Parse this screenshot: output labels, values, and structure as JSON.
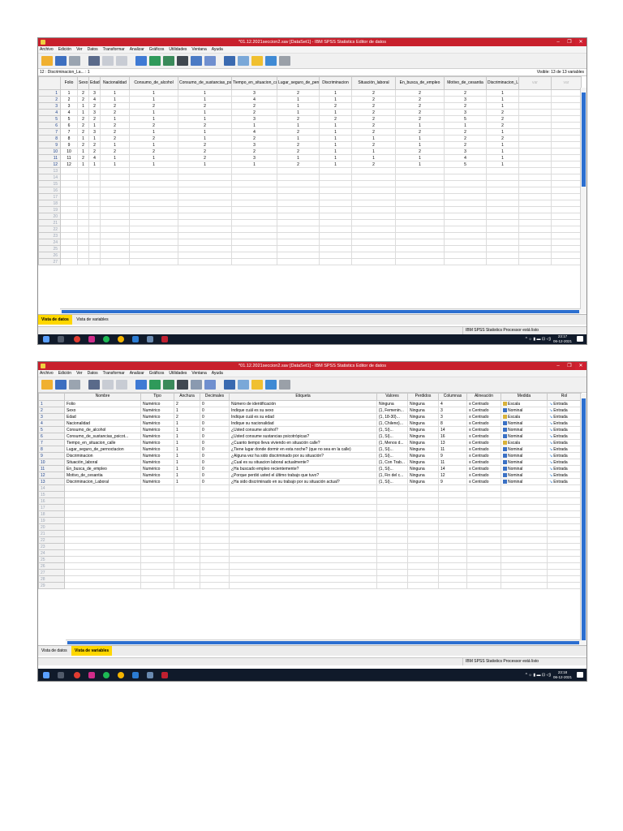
{
  "window": {
    "title": "*01.12.2021seccion2.sav [DataSet1] - IBM SPSS Statistics Editor de datos",
    "minimize": "–",
    "maximize": "❐",
    "close": "✕"
  },
  "menu": [
    "Archivo",
    "Edición",
    "Ver",
    "Datos",
    "Transformar",
    "Analizar",
    "Gráficos",
    "Utilidades",
    "Ventana",
    "Ayuda"
  ],
  "toolbar_icons": [
    "open-icon",
    "save-icon",
    "print-icon",
    "dialog-recall-icon",
    "undo-icon",
    "redo-icon",
    "goto-case-icon",
    "goto-variable-icon",
    "variables-icon",
    "find-icon",
    "insert-cases-icon",
    "insert-variable-icon",
    "split-file-icon",
    "weight-cases-icon",
    "select-cases-icon",
    "value-labels-icon",
    "use-sets-icon"
  ],
  "data_view": {
    "cell_ref": "12 : Discriminacion_La... : 1",
    "visible_label": "Visible: 13 de 13 variables",
    "columns": [
      "Folio",
      "Sexo",
      "Edad",
      "Nacionalidad",
      "Consumo_de_alcohol",
      "Consumo_de_sustancias_psicotropicas",
      "Tiempo_en_situacion_calle",
      "Lugar_seguro_de_pernoctacion",
      "Discriminacion",
      "Situación_laboral",
      "En_busca_de_empleo",
      "Motivo_de_cesantia",
      "Discriminacion_Laboral",
      "var",
      "var"
    ],
    "rows": [
      [
        "1",
        "2",
        "3",
        "1",
        "1",
        "1",
        "3",
        "2",
        "1",
        "2",
        "2",
        "2",
        "1"
      ],
      [
        "2",
        "2",
        "4",
        "1",
        "1",
        "1",
        "4",
        "1",
        "1",
        "2",
        "2",
        "3",
        "1"
      ],
      [
        "3",
        "1",
        "2",
        "2",
        "2",
        "2",
        "2",
        "1",
        "2",
        "2",
        "2",
        "2",
        "1"
      ],
      [
        "4",
        "1",
        "3",
        "2",
        "1",
        "1",
        "2",
        "1",
        "1",
        "2",
        "2",
        "3",
        "2"
      ],
      [
        "5",
        "2",
        "2",
        "1",
        "1",
        "1",
        "3",
        "2",
        "2",
        "2",
        "2",
        "5",
        "2"
      ],
      [
        "6",
        "2",
        "1",
        "2",
        "2",
        "2",
        "1",
        "1",
        "1",
        "2",
        "1",
        "1",
        "2"
      ],
      [
        "7",
        "2",
        "3",
        "2",
        "1",
        "1",
        "4",
        "2",
        "1",
        "2",
        "2",
        "2",
        "1"
      ],
      [
        "8",
        "1",
        "1",
        "2",
        "2",
        "1",
        "2",
        "1",
        "1",
        "1",
        "1",
        "2",
        "2"
      ],
      [
        "9",
        "2",
        "2",
        "1",
        "1",
        "2",
        "3",
        "2",
        "1",
        "2",
        "1",
        "2",
        "1"
      ],
      [
        "10",
        "1",
        "2",
        "2",
        "2",
        "2",
        "2",
        "2",
        "1",
        "1",
        "2",
        "3",
        "1"
      ],
      [
        "11",
        "2",
        "4",
        "1",
        "1",
        "2",
        "3",
        "1",
        "1",
        "1",
        "1",
        "4",
        "1"
      ],
      [
        "12",
        "1",
        "1",
        "1",
        "1",
        "1",
        "1",
        "2",
        "1",
        "2",
        "1",
        "5",
        "1"
      ]
    ],
    "row_numbers": [
      "1",
      "2",
      "3",
      "4",
      "5",
      "6",
      "7",
      "8",
      "9",
      "10",
      "11",
      "12",
      "13",
      "14",
      "15",
      "16",
      "17",
      "18",
      "19",
      "20",
      "21",
      "22",
      "23",
      "24",
      "25",
      "26",
      "27"
    ],
    "tab_data": "Vista de datos",
    "tab_vars": "Vista de variables"
  },
  "var_view": {
    "headers": [
      "Nombre",
      "Tipo",
      "Anchura",
      "Decimales",
      "Etiqueta",
      "Valores",
      "Perdidos",
      "Columnas",
      "Alineación",
      "Medida",
      "Rol"
    ],
    "rows": [
      [
        "Folio",
        "Numérico",
        "2",
        "0",
        "Número de identificación",
        "Ninguna",
        "Ninguna",
        "4",
        "Centrado",
        "Escala",
        "Entrada"
      ],
      [
        "Sexo",
        "Numérico",
        "1",
        "0",
        "Indique cuál es su sexo",
        "{1, Femenin...",
        "Ninguna",
        "3",
        "Centrado",
        "Nominal",
        "Entrada"
      ],
      [
        "Edad",
        "Numérico",
        "2",
        "0",
        "Indique cuál es su edad",
        "{1, 18-30}...",
        "Ninguna",
        "3",
        "Centrado",
        "Escala",
        "Entrada"
      ],
      [
        "Nacionalidad",
        "Numérico",
        "1",
        "0",
        "Indique su nacionalidad",
        "{1, Chileno}...",
        "Ninguna",
        "8",
        "Centrado",
        "Nominal",
        "Entrada"
      ],
      [
        "Consumo_de_alcohol",
        "Numérico",
        "1",
        "0",
        "¿Usted consume alcohol?",
        "{1, Sí}...",
        "Ninguna",
        "14",
        "Centrado",
        "Nominal",
        "Entrada"
      ],
      [
        "Consumo_de_sustancias_psicot...",
        "Numérico",
        "1",
        "0",
        "¿Usted consume sustancias psicotrópicas?",
        "{1, Sí}...",
        "Ninguna",
        "16",
        "Centrado",
        "Nominal",
        "Entrada"
      ],
      [
        "Tiempo_en_situacion_calle",
        "Numérico",
        "1",
        "0",
        "¿Cuanto tiempo lleva viviendo en situación calle?",
        "{1, Menos d...",
        "Ninguna",
        "13",
        "Centrado",
        "Escala",
        "Entrada"
      ],
      [
        "Lugar_seguro_de_pernoctacion",
        "Numérico",
        "1",
        "0",
        "¿Tiene lugar donde dormir en esta noche? (que no sea en la calle)",
        "{1, Sí}...",
        "Ninguna",
        "11",
        "Centrado",
        "Nominal",
        "Entrada"
      ],
      [
        "Discriminacion",
        "Numérico",
        "1",
        "0",
        "¿Alguna vez ha sido discriminado por su situación?",
        "{1, Sí}...",
        "Ninguna",
        "9",
        "Centrado",
        "Nominal",
        "Entrada"
      ],
      [
        "Situación_laboral",
        "Numérico",
        "1",
        "0",
        "¿Cual es su situacion laboral actualmente?",
        "{1, Con Trab...",
        "Ninguna",
        "11",
        "Centrado",
        "Nominal",
        "Entrada"
      ],
      [
        "En_busca_de_empleo",
        "Numérico",
        "1",
        "0",
        "¿Ha buscado empleo recientemente?",
        "{1, Sí}...",
        "Ninguna",
        "14",
        "Centrado",
        "Nominal",
        "Entrada"
      ],
      [
        "Motivo_de_cesantia",
        "Numérico",
        "1",
        "0",
        "¿Porque perdió usted el último trabajo que tuvo?",
        "{1, Fin del c...",
        "Ninguna",
        "12",
        "Centrado",
        "Nominal",
        "Entrada"
      ],
      [
        "Discriminacion_Laboral",
        "Numérico",
        "1",
        "0",
        "¿Ha sido discriminado en su trabajo por su situación actual?",
        "{1, Sí}...",
        "Ninguna",
        "9",
        "Centrado",
        "Nominal",
        "Entrada"
      ]
    ],
    "row_numbers": [
      "1",
      "2",
      "3",
      "4",
      "5",
      "6",
      "7",
      "8",
      "9",
      "10",
      "11",
      "12",
      "13",
      "14",
      "15",
      "16",
      "17",
      "18",
      "19",
      "20",
      "21",
      "22",
      "23",
      "24",
      "25",
      "26",
      "27",
      "28",
      "29"
    ]
  },
  "status": {
    "processor": "IBM SPSS Statistics Processor está listo"
  },
  "taskbar": {
    "shot1_time": "23:17",
    "shot1_date": "06-12-2021",
    "shot2_time": "23:18",
    "shot2_date": "06-12-2021",
    "tray": "^ ☼ ▮ ▬ ⊡ ◁)"
  },
  "colors": {
    "titlebar": "#c8202c",
    "tab_active": "#ffd700",
    "scroll_thumb": "#2c6fd0",
    "taskbar": "#101a2a",
    "scale_icon": "#d9b23a",
    "nominal_icon": "#3a70c4",
    "role_icon": "#1f6fc4"
  }
}
